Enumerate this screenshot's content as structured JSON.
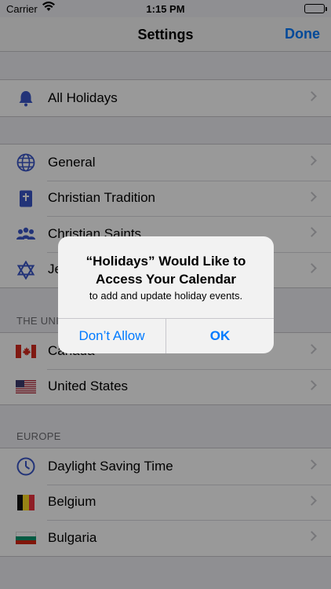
{
  "status_bar": {
    "carrier": "Carrier",
    "time": "1:15 PM"
  },
  "nav": {
    "title": "Settings",
    "done_label": "Done"
  },
  "groups": {
    "top": [
      {
        "label": "All Holidays",
        "icon": "bell-icon"
      }
    ],
    "religious": [
      {
        "label": "General",
        "icon": "globe-icon"
      },
      {
        "label": "Christian Tradition",
        "icon": "bible-icon"
      },
      {
        "label": "Christian Saints",
        "icon": "saints-icon"
      },
      {
        "label": "Je",
        "icon": "star-of-david-icon"
      }
    ],
    "united": {
      "header": "THE UNI",
      "items": [
        {
          "label": "Canada",
          "icon": "canada-flag-icon"
        },
        {
          "label": "United States",
          "icon": "us-flag-icon"
        }
      ]
    },
    "europe": {
      "header": "EUROPE",
      "items": [
        {
          "label": "Daylight Saving Time",
          "icon": "clock-icon"
        },
        {
          "label": "Belgium",
          "icon": "belgium-flag-icon"
        },
        {
          "label": "Bulgaria",
          "icon": "bulgaria-flag-icon"
        }
      ]
    }
  },
  "alert": {
    "title": "“Holidays” Would Like to Access Your Calendar",
    "message": "to add and update holiday events.",
    "deny_label": "Don’t Allow",
    "ok_label": "OK"
  },
  "colors": {
    "accent": "#007aff",
    "icon_blue": "#3a56c9"
  }
}
